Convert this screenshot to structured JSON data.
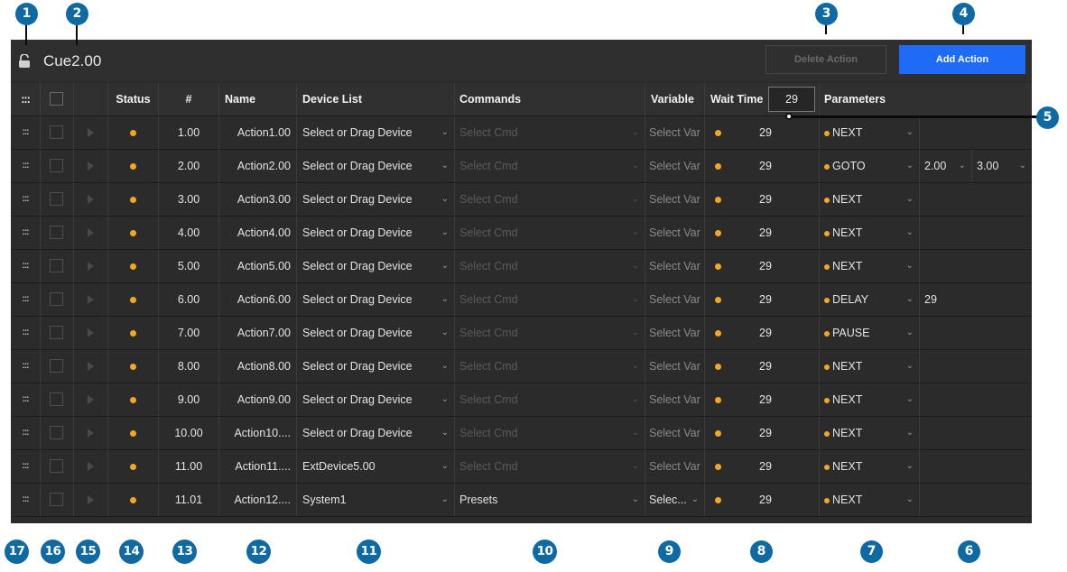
{
  "header": {
    "title": "Cue2.00",
    "delete_label": "Delete Action",
    "add_label": "Add Action"
  },
  "columns": {
    "status": "Status",
    "num": "#",
    "name": "Name",
    "device_list": "Device List",
    "commands": "Commands",
    "variable": "Variable",
    "wait_time": "Wait Time",
    "wait_time_value": "29",
    "parameters": "Parameters"
  },
  "rows": [
    {
      "num": "1.00",
      "name": "Action1.00",
      "device": "Select or Drag Device",
      "command": "Select Cmd",
      "variable": "Select Var",
      "wait": "29",
      "param": "NEXT",
      "extra": ""
    },
    {
      "num": "2.00",
      "name": "Action2.00",
      "device": "Select or Drag Device",
      "command": "Select Cmd",
      "variable": "Select Var",
      "wait": "29",
      "param": "GOTO",
      "extra": "",
      "goto_a": "2.00",
      "goto_b": "3.00"
    },
    {
      "num": "3.00",
      "name": "Action3.00",
      "device": "Select or Drag Device",
      "command": "Select Cmd",
      "variable": "Select Var",
      "wait": "29",
      "param": "NEXT",
      "extra": ""
    },
    {
      "num": "4.00",
      "name": "Action4.00",
      "device": "Select or Drag Device",
      "command": "Select Cmd",
      "variable": "Select Var",
      "wait": "29",
      "param": "NEXT",
      "extra": ""
    },
    {
      "num": "5.00",
      "name": "Action5.00",
      "device": "Select or Drag Device",
      "command": "Select Cmd",
      "variable": "Select Var",
      "wait": "29",
      "param": "NEXT",
      "extra": ""
    },
    {
      "num": "6.00",
      "name": "Action6.00",
      "device": "Select or Drag Device",
      "command": "Select Cmd",
      "variable": "Select Var",
      "wait": "29",
      "param": "DELAY",
      "extra": "29"
    },
    {
      "num": "7.00",
      "name": "Action7.00",
      "device": "Select or Drag Device",
      "command": "Select Cmd",
      "variable": "Select Var",
      "wait": "29",
      "param": "PAUSE",
      "extra": ""
    },
    {
      "num": "8.00",
      "name": "Action8.00",
      "device": "Select or Drag Device",
      "command": "Select Cmd",
      "variable": "Select Var",
      "wait": "29",
      "param": "NEXT",
      "extra": ""
    },
    {
      "num": "9.00",
      "name": "Action9.00",
      "device": "Select or Drag Device",
      "command": "Select Cmd",
      "variable": "Select Var",
      "wait": "29",
      "param": "NEXT",
      "extra": ""
    },
    {
      "num": "10.00",
      "name": "Action10....",
      "device": "Select or Drag Device",
      "command": "Select Cmd",
      "variable": "Select Var",
      "wait": "29",
      "param": "NEXT",
      "extra": ""
    },
    {
      "num": "11.00",
      "name": "Action11....",
      "device": "ExtDevice5.00",
      "command": "Select Cmd",
      "variable": "Select Var",
      "wait": "29",
      "param": "NEXT",
      "extra": ""
    },
    {
      "num": "11.01",
      "name": "Action12....",
      "device": "System1",
      "command": "Presets",
      "variable": "Selec...",
      "wait": "29",
      "param": "NEXT",
      "extra": ""
    }
  ],
  "callouts": [
    "1",
    "2",
    "3",
    "4",
    "5",
    "6",
    "7",
    "8",
    "9",
    "10",
    "11",
    "12",
    "13",
    "14",
    "15",
    "16",
    "17"
  ],
  "colors": {
    "accent": "#1e6cf5",
    "status_dot": "#f5a623",
    "callout": "#0f6aa3",
    "panel": "#2b2b2b"
  },
  "icons": {
    "lock": "lock-open-icon",
    "drag": "drag-handle-icon",
    "play": "play-icon",
    "dropdown": "chevron-down-icon"
  }
}
